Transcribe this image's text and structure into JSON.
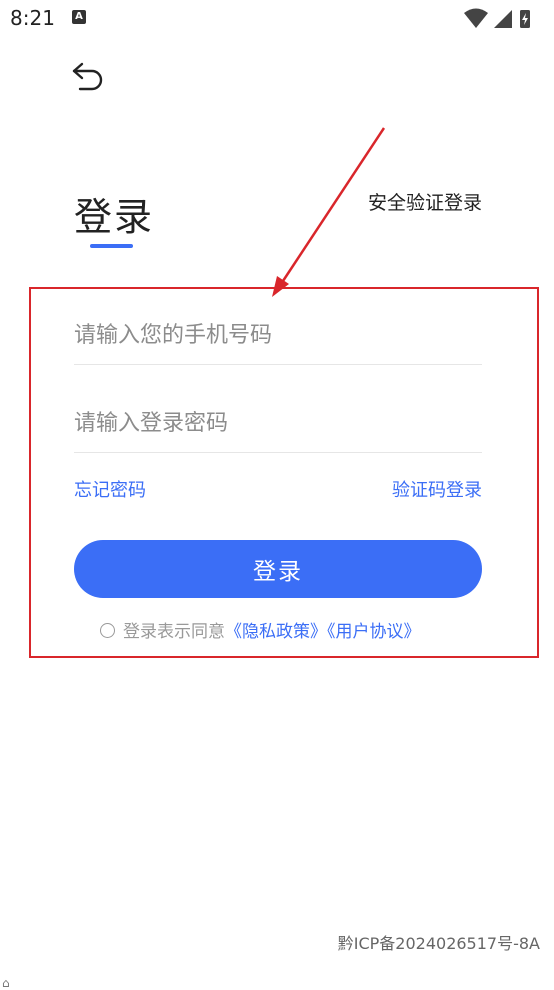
{
  "status_bar": {
    "time": "8:21",
    "notification_icon": "a-letter-icon"
  },
  "nav": {
    "back_icon": "back-arrow-icon"
  },
  "header": {
    "title": "登录",
    "alt_login": "安全验证登录"
  },
  "form": {
    "phone_placeholder": "请输入您的手机号码",
    "password_placeholder": "请输入登录密码",
    "forgot_password": "忘记密码",
    "code_login": "验证码登录",
    "submit_label": "登录"
  },
  "agreement": {
    "prefix": "登录表示同意",
    "privacy": "《隐私政策》",
    "terms": "《用户协议》"
  },
  "footer": {
    "icp": "黔ICP备2024026517号-8A"
  },
  "colors": {
    "accent": "#3b6ef6",
    "annotation": "#d9262b"
  }
}
